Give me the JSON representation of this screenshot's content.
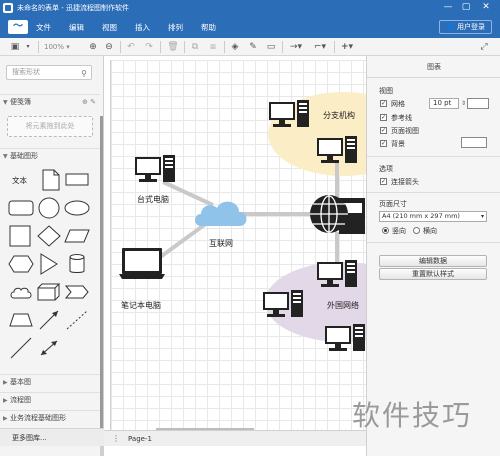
{
  "window": {
    "title": "未命名的表单 - 迅捷流程图制作软件",
    "controls": [
      "—",
      "▢",
      "✕"
    ]
  },
  "menu": {
    "items": [
      "文件",
      "编辑",
      "视图",
      "插入",
      "排列",
      "帮助"
    ],
    "user_login": "用户登录"
  },
  "toolbar": {
    "zoom": "100%"
  },
  "left_panel": {
    "search_placeholder": "搜索形状",
    "sections": {
      "scratchpad": "便笺簿",
      "general": "基础图形",
      "basic": "基本图",
      "flowchart": "流程图",
      "bpmn": "业务流程基础图形"
    },
    "drop_hint": "将元素拖到此处",
    "text_shape": "文本",
    "more_shapes": "更多图库..."
  },
  "diagram": {
    "labels": {
      "branch": "分支机构",
      "desktop": "台式电脑",
      "internet": "互联网",
      "laptop": "笔记本电脑",
      "foreign": "外国网络"
    },
    "colors": {
      "branch_bg": "#fbeec6",
      "foreign_bg": "#e2d8e8",
      "line": "#c9c9c9",
      "cloud": "#8fc3ea",
      "device": "#222222"
    }
  },
  "bottom": {
    "page_tab": "Page-1"
  },
  "right_panel": {
    "header": "图表",
    "view_title": "视图",
    "grid": "网格",
    "grid_size": "10 pt",
    "guides": "参考线",
    "page_view": "页面视图",
    "background": "背景",
    "options_title": "选项",
    "connection_arrows": "连接箭头",
    "paper_title": "页面尺寸",
    "paper_size": "A4 (210 mm x 297 mm)",
    "portrait": "竖向",
    "landscape": "横向",
    "edit_data": "编辑数据",
    "reset_style": "重置默认样式"
  },
  "watermark": "软件技巧"
}
